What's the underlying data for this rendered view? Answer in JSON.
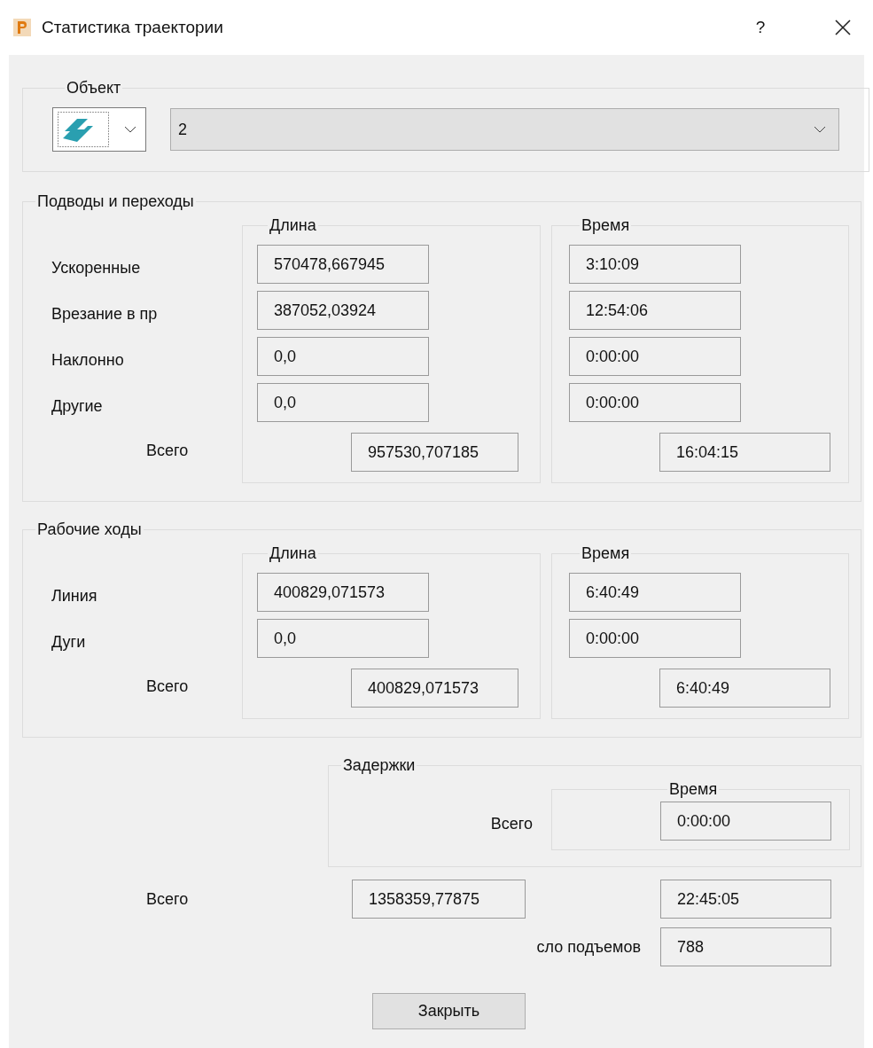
{
  "window": {
    "title": "Статистика траектории",
    "help": "?"
  },
  "object": {
    "legend": "Объект",
    "value": "2"
  },
  "sections": [
    {
      "legend": "Подводы и переходы",
      "length_legend": "Длина",
      "time_legend": "Время",
      "rows": [
        {
          "label": "Ускоренные",
          "length": "570478,667945",
          "time": "3:10:09"
        },
        {
          "label": "Врезание в пр",
          "length": "387052,03924",
          "time": "12:54:06"
        },
        {
          "label": "Наклонно",
          "length": "0,0",
          "time": "0:00:00"
        },
        {
          "label": "Другие",
          "length": "0,0",
          "time": "0:00:00"
        }
      ],
      "total_label": "Всего",
      "total_length": "957530,707185",
      "total_time": "16:04:15"
    },
    {
      "legend": "Рабочие ходы",
      "length_legend": "Длина",
      "time_legend": "Время",
      "rows": [
        {
          "label": "Линия",
          "length": "400829,071573",
          "time": "6:40:49"
        },
        {
          "label": "Дуги",
          "length": "0,0",
          "time": "0:00:00"
        }
      ],
      "total_label": "Всего",
      "total_length": "400829,071573",
      "total_time": "6:40:49"
    }
  ],
  "dwell": {
    "legend": "Задержки",
    "time_legend": "Время",
    "total_label": "Всего",
    "total_time": "0:00:00"
  },
  "grand_total": {
    "label": "Всего",
    "length": "1358359,77875",
    "time": "22:45:05"
  },
  "retracts": {
    "label": "сло подъемов",
    "value": "788"
  },
  "close_button": "Закрыть"
}
